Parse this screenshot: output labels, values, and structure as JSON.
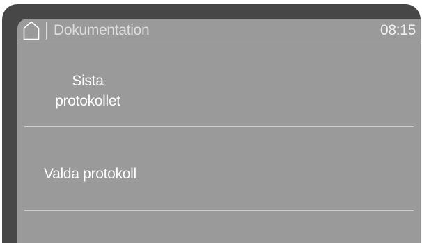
{
  "header": {
    "home_icon": "home-icon",
    "title": "Dokumentation",
    "time": "08:15"
  },
  "menu": {
    "items": [
      {
        "line1": "Sista",
        "line2": "protokollet"
      },
      {
        "label": "Valda protokoll"
      }
    ]
  },
  "colors": {
    "frame": "#474747",
    "screen": "#9a9a9a",
    "text": "#ffffff",
    "divider": "#d2d2d2"
  }
}
